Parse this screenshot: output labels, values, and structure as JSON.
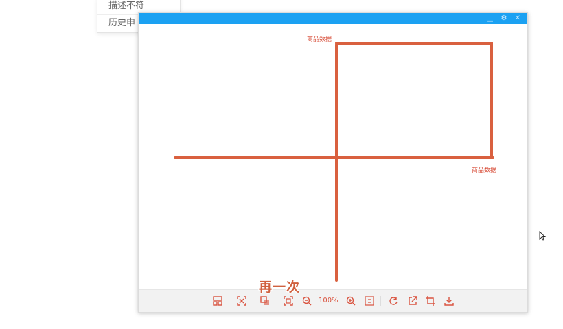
{
  "background_menu": {
    "items": [
      "描述不符",
      "历史申"
    ]
  },
  "viewer": {
    "title_bar_color": "#1ba1f2",
    "drawing": {
      "stroke_color": "#d9603f",
      "label_top": "商品数据",
      "label_right": "商品数据"
    },
    "toolbar": {
      "zoom_label": "100%",
      "tools": [
        "layout-icon",
        "fit-icon",
        "original-size-icon",
        "full-screen-icon",
        "zoom-out-icon",
        "zoom-in-icon",
        "actual-ratio-icon",
        "rotate-icon",
        "open-external-icon",
        "crop-icon",
        "download-icon"
      ]
    }
  },
  "subtitle": "再一次"
}
